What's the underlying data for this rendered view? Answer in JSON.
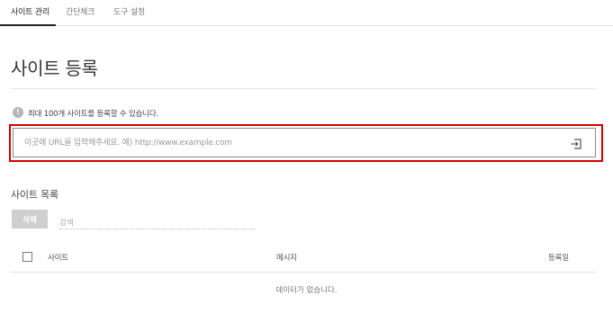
{
  "tabs": [
    {
      "label": "사이트 관리",
      "active": true
    },
    {
      "label": "간단체크",
      "active": false
    },
    {
      "label": "도구 설정",
      "active": false
    }
  ],
  "page": {
    "title": "사이트 등록",
    "info": "최대 100개 사이트를 등록할 수 있습니다.",
    "info_icon": "info-icon"
  },
  "url_input": {
    "value": "",
    "placeholder": "이곳에 URL을 입력해주세요. 예) http://www.example.com",
    "submit_icon": "enter-icon"
  },
  "site_list": {
    "title": "사이트 목록",
    "delete_label": "삭제",
    "search_placeholder": "검색",
    "columns": {
      "site": "사이트",
      "message": "메시지",
      "registered": "등록일"
    },
    "empty": "데이터가 없습니다."
  },
  "colors": {
    "highlight": "#d40000",
    "active_tab": "#222222",
    "disabled_button": "#cfcfcf"
  }
}
